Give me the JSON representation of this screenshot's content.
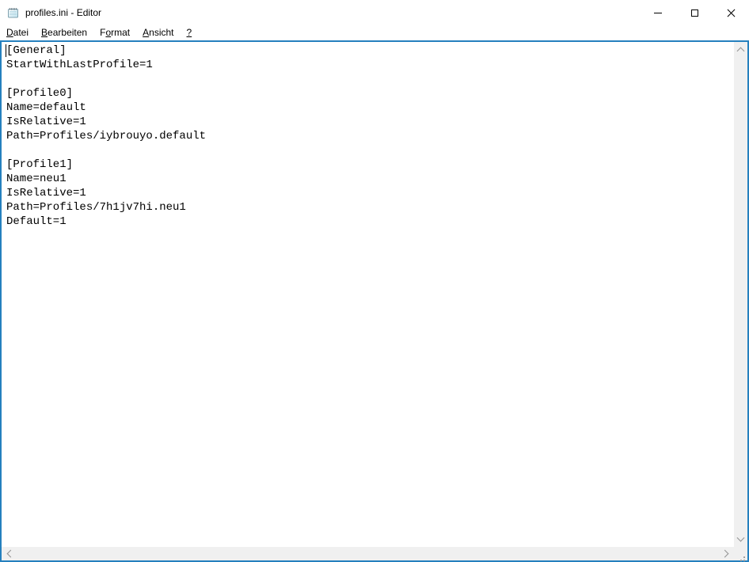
{
  "window": {
    "title": "profiles.ini - Editor",
    "app_icon": "notepad-icon",
    "controls": [
      {
        "id": "minimize",
        "icon": "minimize-icon"
      },
      {
        "id": "maximize",
        "icon": "maximize-icon"
      },
      {
        "id": "close",
        "icon": "close-icon"
      }
    ]
  },
  "menu": {
    "items": [
      {
        "id": "datei",
        "label": "Datei",
        "underline_index": 0
      },
      {
        "id": "bearbeiten",
        "label": "Bearbeiten",
        "underline_index": 0
      },
      {
        "id": "format",
        "label": "Format",
        "underline_index": 1
      },
      {
        "id": "ansicht",
        "label": "Ansicht",
        "underline_index": 0
      },
      {
        "id": "hilfe",
        "label": "?",
        "underline_index": 0
      }
    ]
  },
  "editor": {
    "caret_visible": true,
    "lines": [
      "[General]",
      "StartWithLastProfile=1",
      "",
      "[Profile0]",
      "Name=default",
      "IsRelative=1",
      "Path=Profiles/iybrouyo.default",
      "",
      "[Profile1]",
      "Name=neu1",
      "IsRelative=1",
      "Path=Profiles/7h1jv7hi.neu1",
      "Default=1"
    ]
  },
  "colors": {
    "accent_border": "#2580be",
    "titlebar_bg": "#ffffff",
    "scrollbar_track": "#f0f0f0",
    "scrollbar_arrow": "#929292",
    "text": "#000000"
  }
}
